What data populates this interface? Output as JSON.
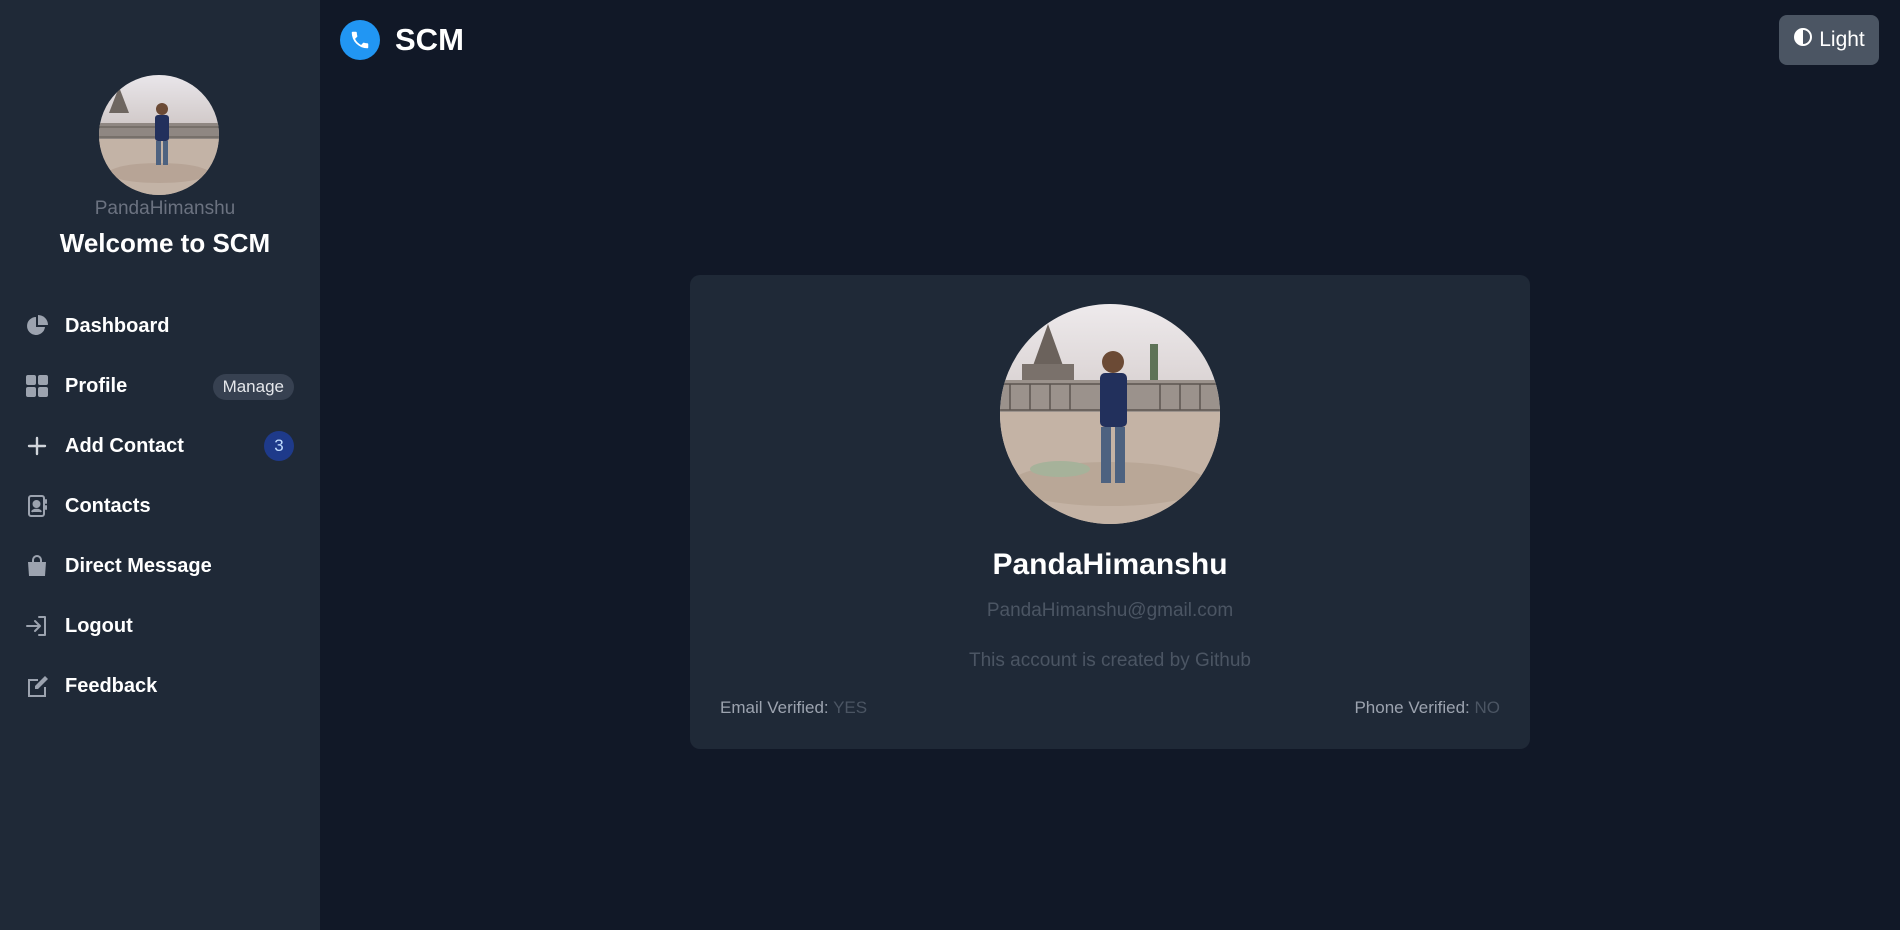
{
  "app": {
    "brand": "SCM"
  },
  "header": {
    "theme_button_label": "Light"
  },
  "sidebar": {
    "username": "PandaHimanshu",
    "welcome": "Welcome to SCM",
    "items": [
      {
        "label": "Dashboard",
        "icon": "pie-chart-icon"
      },
      {
        "label": "Profile",
        "icon": "grid-icon",
        "badge": "Manage"
      },
      {
        "label": "Add Contact",
        "icon": "plus-icon",
        "badge": "3"
      },
      {
        "label": "Contacts",
        "icon": "address-book-icon"
      },
      {
        "label": "Direct Message",
        "icon": "shopping-bag-icon"
      },
      {
        "label": "Logout",
        "icon": "logout-icon"
      },
      {
        "label": "Feedback",
        "icon": "edit-icon"
      }
    ]
  },
  "profile": {
    "name": "PandaHimanshu",
    "email": "PandaHimanshu@gmail.com",
    "created_by": "This account is created by Github",
    "email_verified_label": "Email Verified:",
    "email_verified_value": "YES",
    "phone_verified_label": "Phone Verified:",
    "phone_verified_value": "NO"
  },
  "colors": {
    "background": "#111827",
    "sidebar": "#1f2937",
    "card": "#1f2937",
    "accent": "#2196f3",
    "badge_count_bg": "#1e3a8a"
  }
}
